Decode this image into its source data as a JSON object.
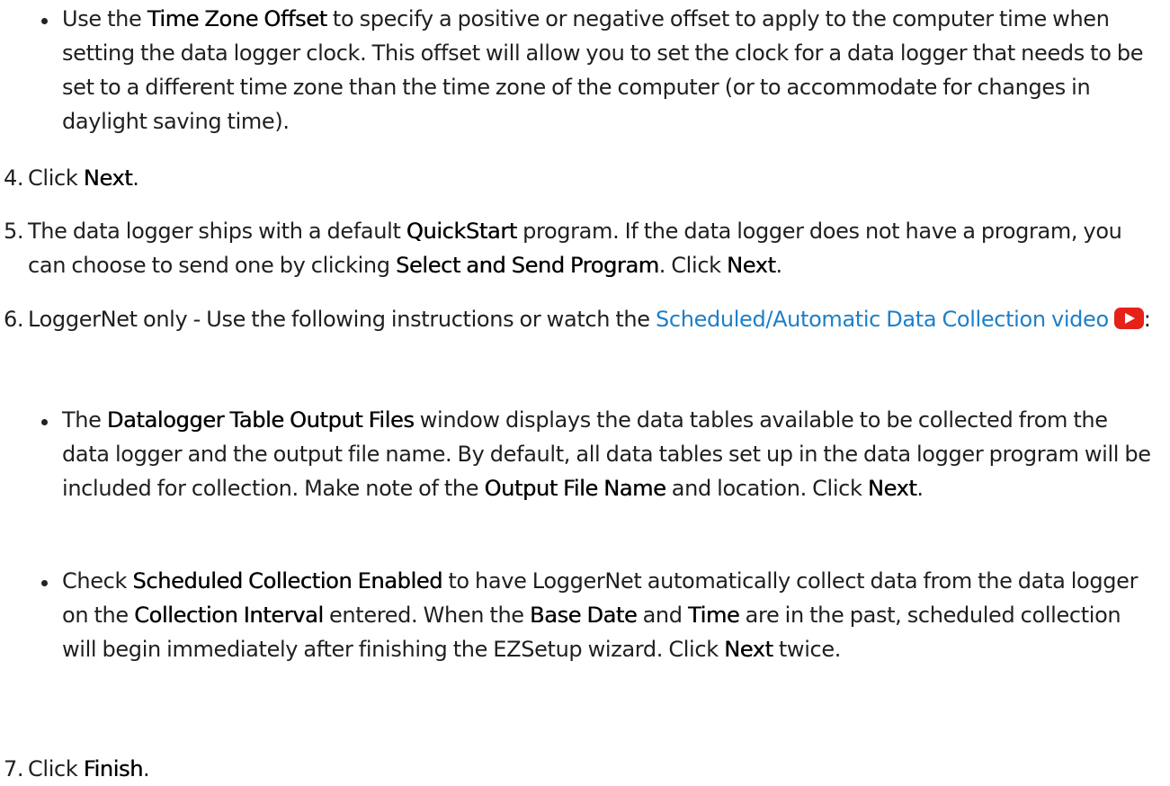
{
  "bullet_time_zone": {
    "pre": "Use the ",
    "term": "Time Zone Offset",
    "post": " to specify a positive or negative offset to apply to the computer time when setting the data logger clock. This offset will allow you to set the clock for a data logger that needs to be set to a different time zone than the time zone of the computer (or to accommodate for changes in daylight saving time)."
  },
  "step4": {
    "number": "4.",
    "pre": "Click ",
    "term": "Next",
    "post": "."
  },
  "step5": {
    "number": "5.",
    "pre": "The data logger ships with a default ",
    "term1": "QuickStart",
    "mid": " program. If the data logger does not have a program, you can choose to send one by clicking ",
    "term2": "Select and Send Program",
    "mid2": ". Click ",
    "term3": "Next",
    "post": "."
  },
  "step6": {
    "number": "6.",
    "pre": "LoggerNet only - Use the following instructions or watch the ",
    "link": "Scheduled/Automatic Data Collection video",
    "post": ":",
    "icon": "youtube-play-icon"
  },
  "bullet_table_output": {
    "pre": "The ",
    "term1": "Datalogger Table Output Files",
    "mid": " window displays the data tables available to be collected from the data logger and the output file name. By default, all data tables set up in the data logger program will be included for collection. Make note of the ",
    "term2": "Output File Name",
    "mid2": " and location. Click ",
    "term3": "Next",
    "post": "."
  },
  "bullet_scheduled": {
    "pre": "Check ",
    "term1": "Scheduled Collection Enabled",
    "mid1": " to have LoggerNet automatically collect data from the data logger on the ",
    "term2": "Collection Interval",
    "mid2": " entered. When the ",
    "term3": "Base Date",
    "mid3": " and ",
    "term4": "Time",
    "mid4": " are in the past, scheduled collection will begin immediately after finishing the EZSetup wizard. Click ",
    "term5": "Next",
    "post": " twice."
  },
  "step7": {
    "number": "7.",
    "pre": "Click ",
    "term": "Finish",
    "post": "."
  },
  "colors": {
    "text": "#1f1f1f",
    "link": "#1d7fc9",
    "youtube_red": "#e62117"
  }
}
